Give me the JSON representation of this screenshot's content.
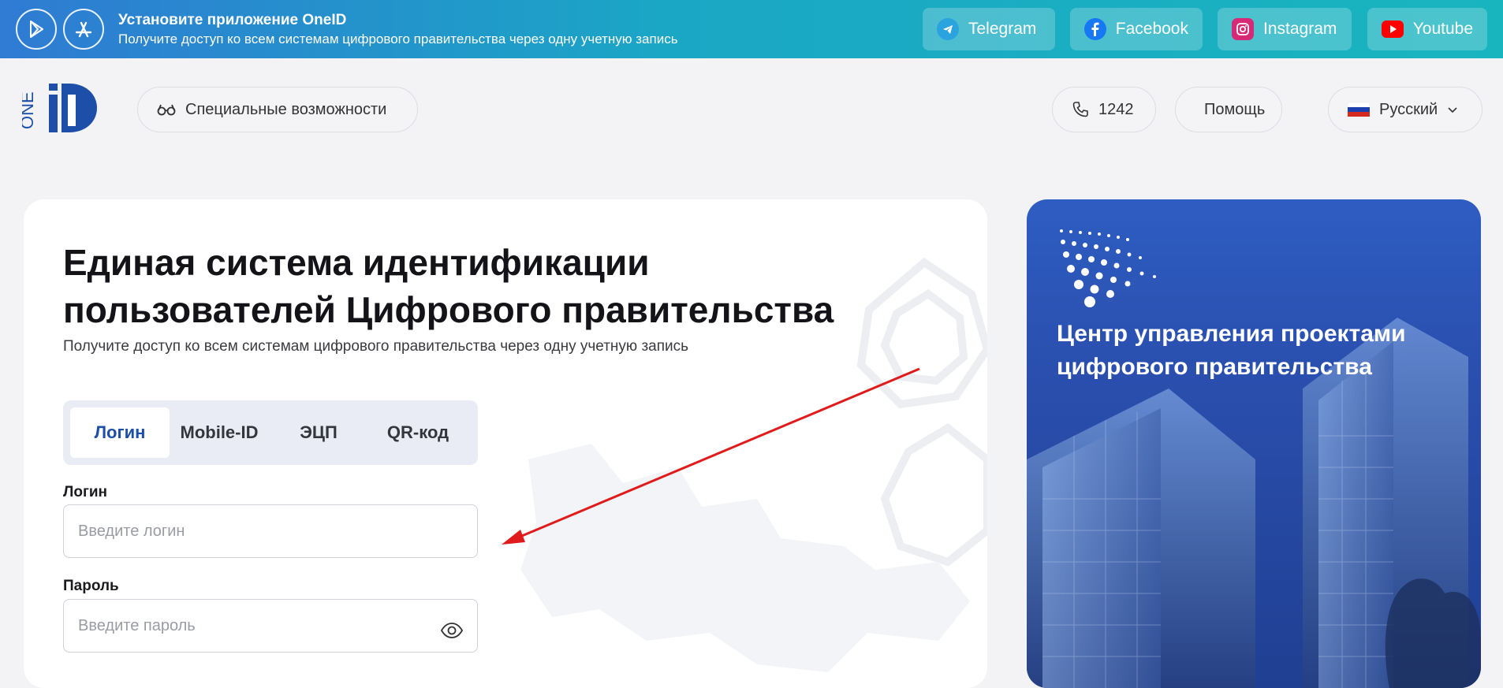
{
  "banner": {
    "title": "Установите приложение OneID",
    "subtitle": "Получите доступ ко всем системам цифрового правительства через одну учетную запись",
    "stores": [
      {
        "icon": "google-play-icon"
      },
      {
        "icon": "app-store-icon"
      }
    ],
    "socials": [
      {
        "label": "Telegram",
        "icon": "telegram-icon",
        "color": "#2aa3df"
      },
      {
        "label": "Facebook",
        "icon": "facebook-icon",
        "color": "#1877f2"
      },
      {
        "label": "Instagram",
        "icon": "instagram-icon",
        "color": "#d62976"
      },
      {
        "label": "Youtube",
        "icon": "youtube-icon",
        "color": "#ff0000"
      }
    ]
  },
  "header": {
    "logo_text": "ONE",
    "accessibility": "Специальные возможности",
    "phone": "1242",
    "help": "Помощь",
    "language": "Русский"
  },
  "main": {
    "title": "Единая система идентификации пользователей Цифрового правительства",
    "subtitle": "Получите доступ ко всем системам цифрового правительства через одну учетную запись",
    "tabs": [
      {
        "label": "Логин",
        "active": true
      },
      {
        "label": "Mobile-ID",
        "active": false
      },
      {
        "label": "ЭЦП",
        "active": false
      },
      {
        "label": "QR-код",
        "active": false
      }
    ],
    "login": {
      "label": "Логин",
      "placeholder": "Введите логин"
    },
    "password": {
      "label": "Пароль",
      "placeholder": "Введите пароль"
    }
  },
  "promo": {
    "text": "Центр управления проектами цифрового правительства"
  },
  "colors": {
    "accent": "#1d4fa8",
    "banner_start": "#2f7bd3",
    "banner_end": "#19b5bf",
    "annotation_arrow": "#e01b1b"
  }
}
